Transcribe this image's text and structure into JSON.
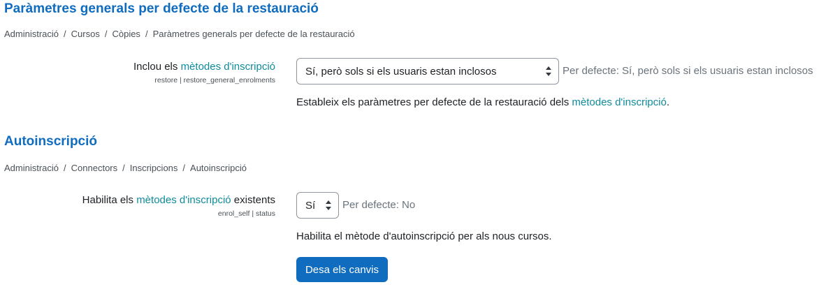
{
  "section1": {
    "title": "Paràmetres generals per defecte de la restauració",
    "breadcrumb": [
      "Administració",
      "Cursos",
      "Còpies",
      "Paràmetres generals per defecte de la restauració"
    ],
    "setting": {
      "label_prefix": "Inclou els ",
      "label_link": "mètodes d'inscripció",
      "label_suffix": "",
      "key": "restore | restore_general_enrolments",
      "value": "Sí, però sols si els usuaris estan inclosos",
      "default": "Per defecte: Sí, però sols si els usuaris estan inclosos",
      "desc_prefix": "Estableix els paràmetres per defecte de la restauració dels ",
      "desc_link": "mètodes d'inscripció",
      "desc_suffix": "."
    }
  },
  "section2": {
    "title": "Autoinscripció",
    "breadcrumb": [
      "Administració",
      "Connectors",
      "Inscripcions",
      "Autoinscripció"
    ],
    "setting": {
      "label_prefix": "Habilita els ",
      "label_link": "mètodes d'inscripció",
      "label_suffix": " existents",
      "key": "enrol_self | status",
      "value": "Sí",
      "default": "Per defecte: No",
      "desc": "Habilita el mètode d'autoinscripció per als nous cursos."
    }
  },
  "save_button": "Desa els canvis",
  "colors": {
    "heading": "#0f6cbf",
    "link": "#0f8b9c",
    "button": "#0f6cbf"
  }
}
